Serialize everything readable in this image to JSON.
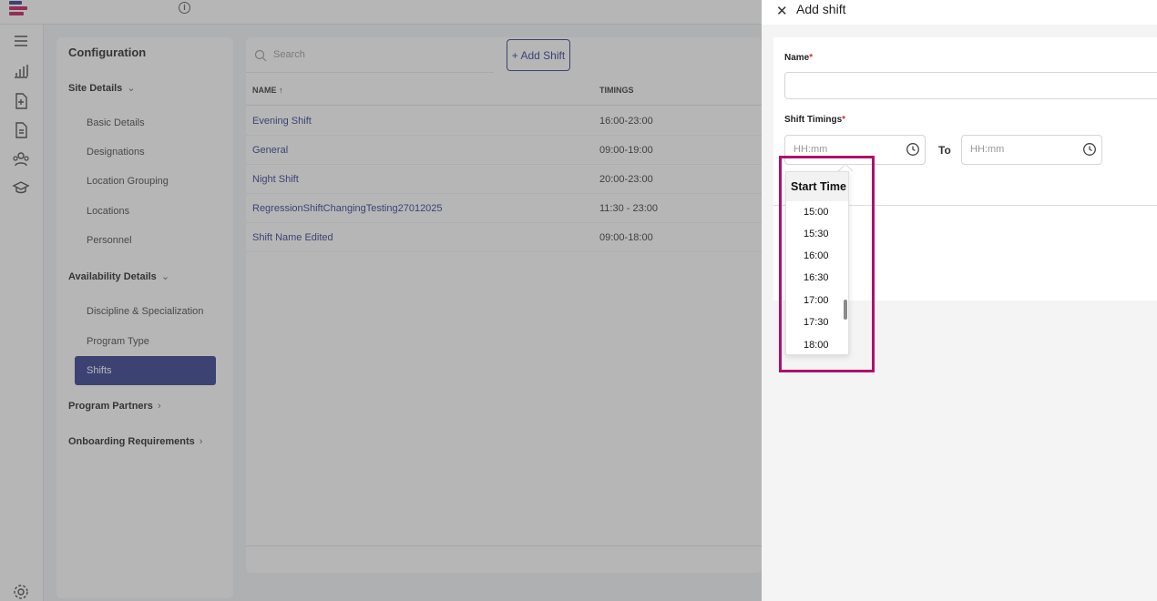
{
  "app": {
    "nav": {
      "title": "Configuration",
      "groups": [
        {
          "label": "Site Details",
          "chevron": "⌄"
        },
        {
          "label": "Availability Details",
          "chevron": "⌄"
        },
        {
          "label": "Program Partners",
          "chevron": "›"
        },
        {
          "label": "Onboarding Requirements",
          "chevron": "›"
        }
      ],
      "site_items": [
        "Basic Details",
        "Designations",
        "Location Grouping",
        "Locations",
        "Personnel"
      ],
      "availability_items": [
        "Discipline & Specialization",
        "Program Type",
        "Shifts"
      ]
    },
    "list": {
      "search_placeholder": "Search",
      "add_button": "+ Add Shift",
      "columns": [
        "NAME ↑",
        "TIMINGS"
      ],
      "rows": [
        {
          "name": "Evening Shift",
          "timings": "16:00-23:00"
        },
        {
          "name": "General",
          "timings": "09:00-19:00"
        },
        {
          "name": "Night Shift",
          "timings": "20:00-23:00"
        },
        {
          "name": "RegressionShiftChangingTesting27012025",
          "timings": "11:30 - 23:00"
        },
        {
          "name": "Shift Name Edited",
          "timings": "09:00-18:00"
        }
      ]
    }
  },
  "drawer": {
    "close_glyph": "✕",
    "title": "Add shift",
    "name_label": "Name",
    "required_mark": "*",
    "timings_label": "Shift Timings",
    "start_placeholder": "HH:mm",
    "end_placeholder": "HH:mm",
    "to_label": "To"
  },
  "time_dropdown": {
    "header": "Start Time",
    "options": [
      "15:00",
      "15:30",
      "16:00",
      "16:30",
      "17:00",
      "17:30",
      "18:00"
    ]
  },
  "icons": [
    "logo",
    "info-icon",
    "menu-icon",
    "chart-icon",
    "add-document-icon",
    "document-icon",
    "people-icon",
    "graduation-cap-icon",
    "settings-icon",
    "search-icon",
    "close-icon",
    "clock-icon"
  ],
  "colors": {
    "brand_navy": "#2d3a8c",
    "brand_magenta": "#c2185b",
    "highlight": "#b0106a"
  }
}
